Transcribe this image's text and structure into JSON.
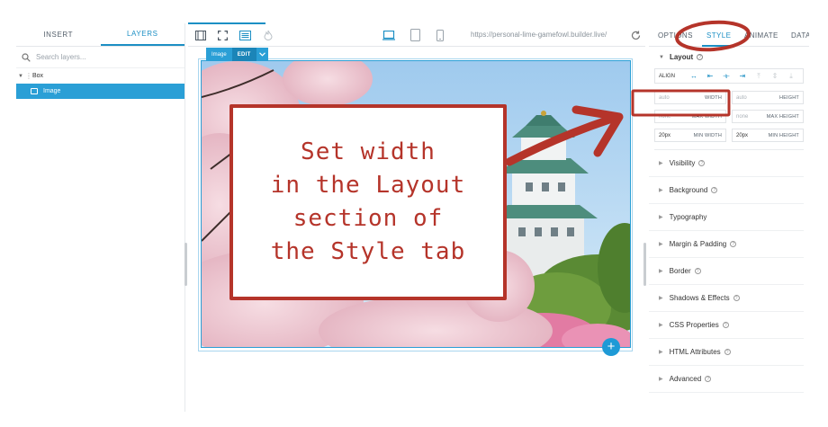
{
  "left_panel": {
    "tabs": [
      {
        "label": "INSERT"
      },
      {
        "label": "LAYERS"
      }
    ],
    "search_placeholder": "Search layers...",
    "tree": {
      "box": "Box",
      "image": "Image"
    }
  },
  "toolbar": {
    "url": "https://personal-lime-gamefowl.builder.live/"
  },
  "canvas": {
    "chip_label": "Image",
    "chip_edit": "EDIT",
    "add_symbol": "+"
  },
  "annotation": {
    "lines": [
      "Set width",
      "in the Layout",
      "section of",
      "the Style tab"
    ],
    "color": "#b5342a"
  },
  "right_panel": {
    "tabs": [
      {
        "label": "OPTIONS"
      },
      {
        "label": "STYLE"
      },
      {
        "label": "ANIMATE"
      },
      {
        "label": "DATA"
      }
    ],
    "layout_title": "Layout",
    "align_label": "ALIGN",
    "fields": {
      "width": {
        "value": "auto",
        "name": "WIDTH"
      },
      "height": {
        "value": "auto",
        "name": "HEIGHT"
      },
      "max_width": {
        "value": "none",
        "name": "MAX WIDTH"
      },
      "max_height": {
        "value": "none",
        "name": "MAX HEIGHT"
      },
      "min_width": {
        "value": "20px",
        "name": "MIN WIDTH"
      },
      "min_height": {
        "value": "20px",
        "name": "MIN HEIGHT"
      }
    },
    "sections": [
      "Visibility",
      "Background",
      "Typography",
      "Margin & Padding",
      "Border",
      "Shadows & Effects",
      "CSS Properties",
      "HTML Attributes",
      "Advanced"
    ]
  },
  "colors": {
    "accent": "#1c8fc4",
    "selection": "#2a9fd6",
    "annotation": "#b5342a"
  }
}
